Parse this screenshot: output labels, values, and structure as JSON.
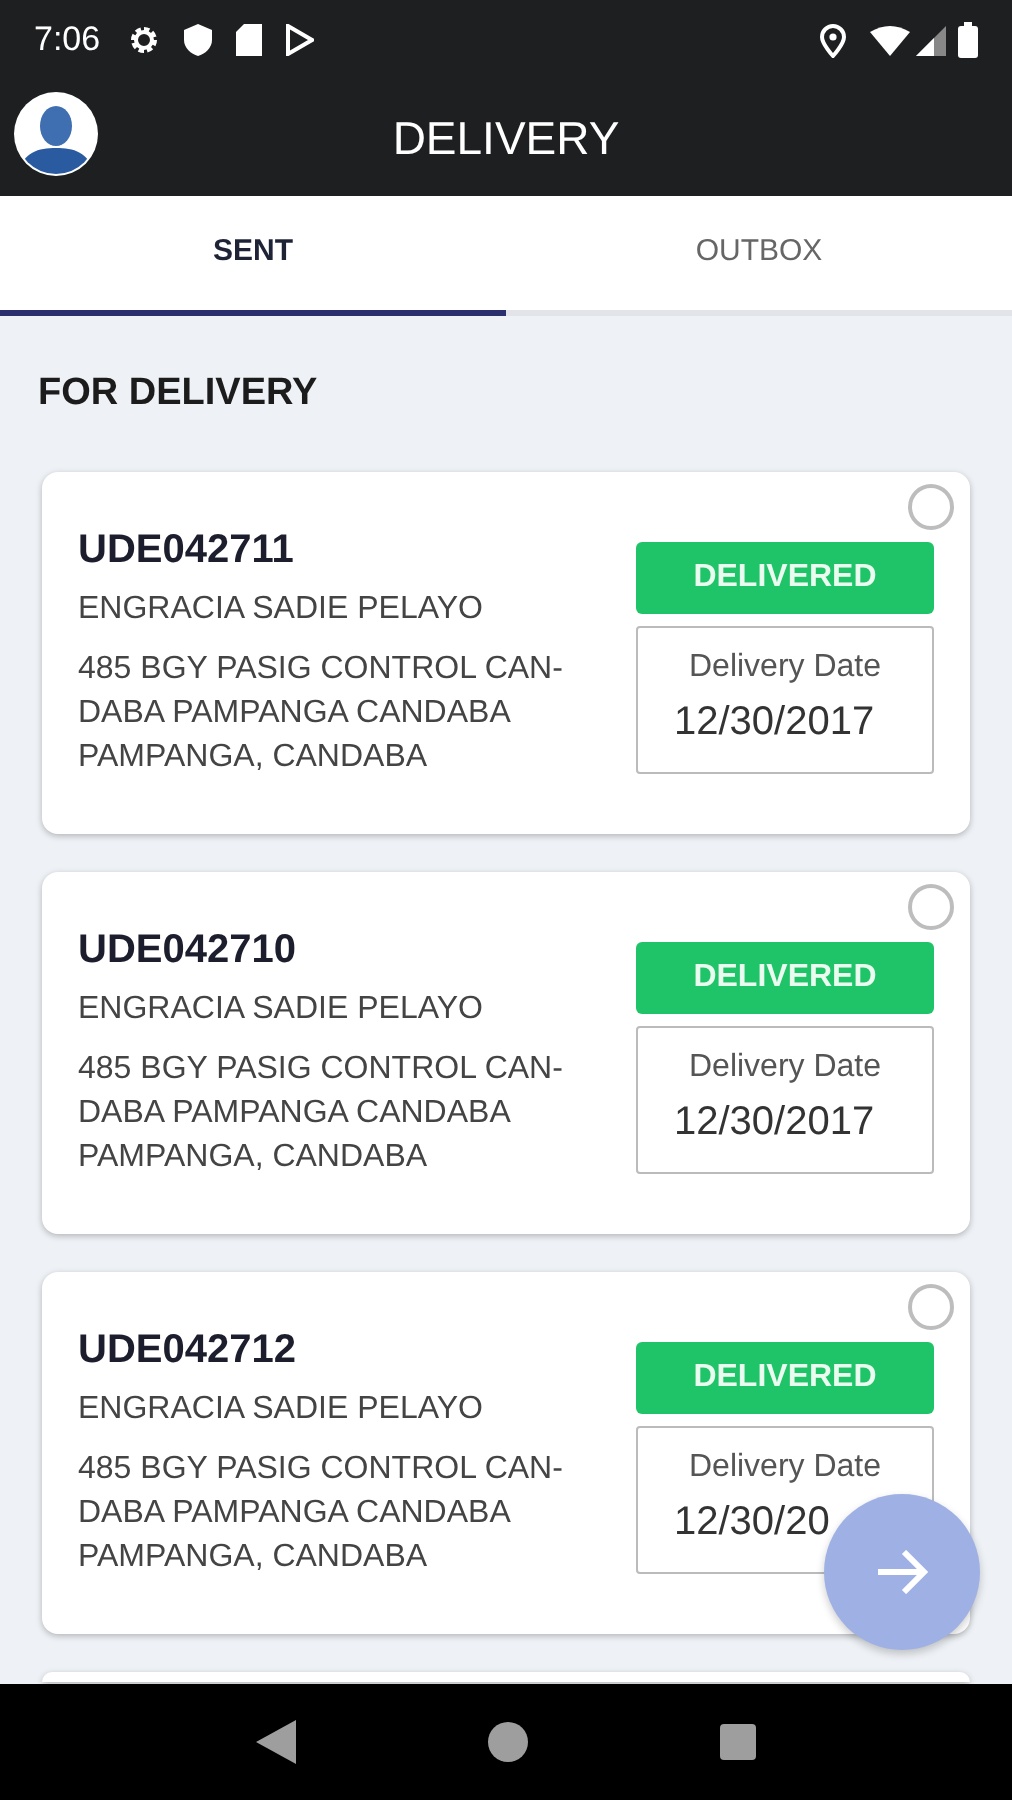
{
  "status_bar": {
    "time": "7:06"
  },
  "app_bar": {
    "title": "DELIVERY"
  },
  "tabs": [
    {
      "label": "SENT",
      "selected": true
    },
    {
      "label": "OUTBOX",
      "selected": false
    }
  ],
  "section_title": "FOR DELIVERY",
  "deliveries": [
    {
      "code": "UDE042711",
      "name": "ENGRACIA SADIE PELAYO",
      "address_lines": [
        "485 BGY PASIG CONTROL CAN-",
        "DABA PAMPANGA CANDABA",
        "PAMPANGA, CANDABA"
      ],
      "status": "DELIVERED",
      "date_label": "Delivery Date",
      "date": "12/30/2017",
      "selected": false
    },
    {
      "code": "UDE042710",
      "name": "ENGRACIA SADIE PELAYO",
      "address_lines": [
        "485 BGY PASIG CONTROL CAN-",
        "DABA PAMPANGA CANDABA",
        "PAMPANGA, CANDABA"
      ],
      "status": "DELIVERED",
      "date_label": "Delivery Date",
      "date": "12/30/2017",
      "selected": false
    },
    {
      "code": "UDE042712",
      "name": "ENGRACIA SADIE PELAYO",
      "address_lines": [
        "485 BGY PASIG CONTROL CAN-",
        "DABA PAMPANGA CANDABA",
        "PAMPANGA, CANDABA"
      ],
      "status": "DELIVERED",
      "date_label": "Delivery Date",
      "date": "12/30/20",
      "selected": false
    }
  ]
}
